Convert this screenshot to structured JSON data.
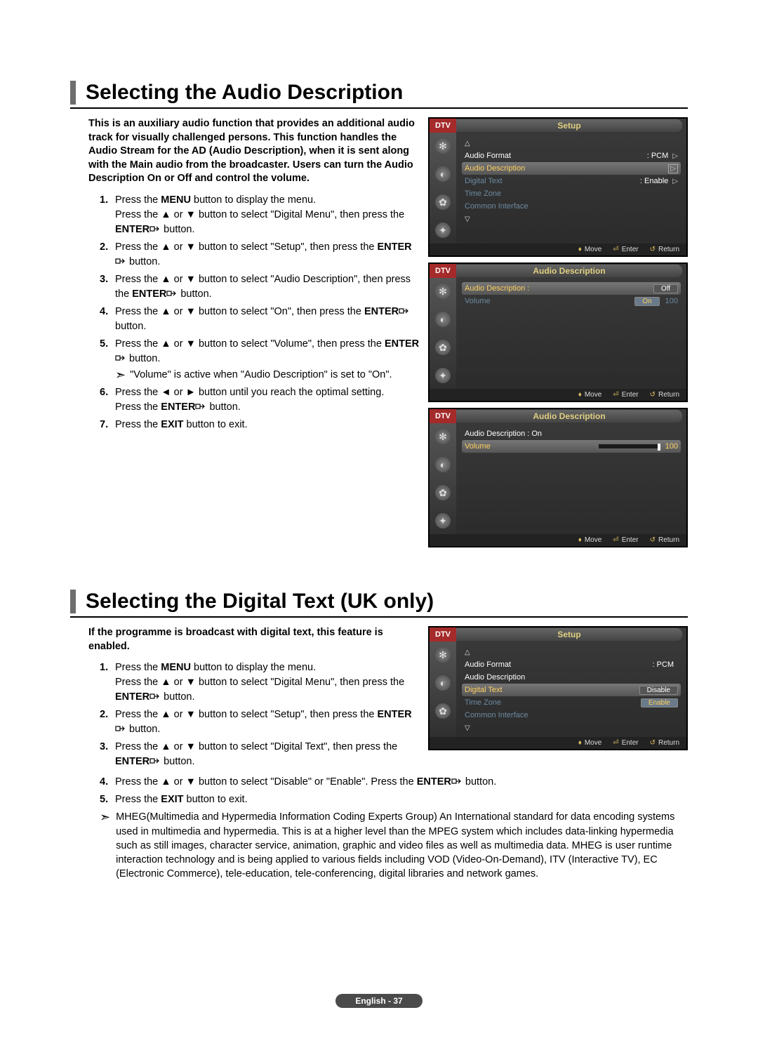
{
  "section1": {
    "title": "Selecting the Audio Description",
    "intro": "This is an auxiliary audio function that provides an additional audio track for visually challenged persons. This function handles the Audio Stream for the AD (Audio Description), when it is sent along with the Main audio from the broadcaster. Users can turn the Audio Description On or Off and control the volume.",
    "steps": {
      "s1a": "Press the ",
      "s1b": "MENU",
      "s1c": " button to display the menu.",
      "s1d": "Press the ▲ or ▼ button to select \"Digital Menu\", then press the ",
      "s1e": "ENTER",
      "s1f": " button.",
      "s2a": "Press the ▲ or ▼ button to select \"Setup\", then press the ",
      "s2b": "ENTER",
      "s2c": " button.",
      "s3a": "Press the ▲ or ▼ button to select \"Audio Description\", then press the ",
      "s3b": "ENTER",
      "s3c": " button.",
      "s4a": "Press the ▲ or ▼ button to select \"On\", then press the ",
      "s4b": "ENTER",
      "s4c": " button.",
      "s5a": "Press the ▲ or ▼ button to select \"Volume\", then press the ",
      "s5b": "ENTER",
      "s5c": " button.",
      "s5note": "\"Volume\" is active when \"Audio Description\" is set to \"On\".",
      "s6a": "Press the ◄ or ► button until you reach the optimal setting.",
      "s6b": "Press the ",
      "s6c": "ENTER",
      "s6d": " button.",
      "s7a": "Press the ",
      "s7b": "EXIT",
      "s7c": " button to exit."
    }
  },
  "section2": {
    "title": "Selecting the Digital Text (UK only)",
    "intro": "If the programme is broadcast with digital text, this feature is enabled.",
    "steps": {
      "s1a": "Press the ",
      "s1b": "MENU",
      "s1c": " button to display the menu.",
      "s1d": "Press the ▲ or ▼ button to select \"Digital Menu\", then press the ",
      "s1e": "ENTER",
      "s1f": " button.",
      "s2a": "Press the ▲ or ▼ button to select \"Setup\", then press the ",
      "s2b": "ENTER",
      "s2c": " button.",
      "s3a": "Press the ▲ or ▼ button to select \"Digital Text\", then press the ",
      "s3b": "ENTER",
      "s3c": " button.",
      "s4a": "Press the ▲ or ▼ button to select \"Disable\" or \"Enable\". Press the ",
      "s4b": "ENTER",
      "s4c": " button.",
      "s5a": "Press the ",
      "s5b": "EXIT",
      "s5c": " button to exit."
    },
    "mheg": "MHEG(Multimedia and Hypermedia Information Coding Experts Group) An International standard for data encoding systems used in multimedia and hypermedia. This is at a higher level than the MPEG system which includes data-linking hypermedia such as still images, character service, animation, graphic and video files as well as multimedia data. MHEG is user runtime interaction technology and is being applied to various fields including VOD (Video-On-Demand), ITV (Interactive TV), EC (Electronic Commerce), tele-education, tele-conferencing, digital libraries and network games."
  },
  "osd": {
    "dtv": "DTV",
    "setup": "Setup",
    "audioDesc": "Audio Description",
    "audioFormat": "Audio Format",
    "pcm": ": PCM",
    "digitalText": "Digital Text",
    "enable": ": Enable",
    "timeZone": "Time Zone",
    "commonIf": "Common Interface",
    "audioDescLabel": "Audio Description :",
    "off": "Off",
    "on": "On",
    "onColon": "Audio Description : On",
    "volume": "Volume",
    "v100": "100",
    "disable": "Disable",
    "enableBox": "Enable",
    "move": "Move",
    "enter": "Enter",
    "return": "Return"
  },
  "footer": "English - 37"
}
